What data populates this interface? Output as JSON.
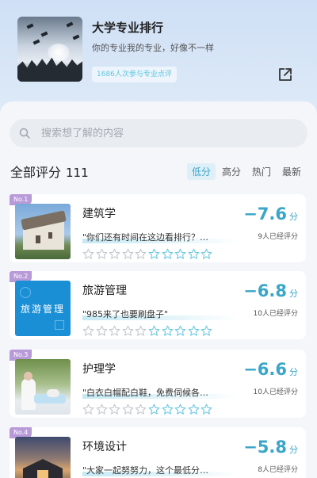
{
  "header": {
    "title": "大学专业排行",
    "subtitle": "你的专业我的专业，好像不一样",
    "joined": "1686人次参与专业点评",
    "share_icon": "share-icon"
  },
  "search": {
    "placeholder": "搜索想了解的内容",
    "value": ""
  },
  "list_header": {
    "label": "全部评分",
    "count": "111",
    "sort_tabs": [
      "低分",
      "高分",
      "热门",
      "最新"
    ],
    "active_sort": "低分"
  },
  "colors": {
    "accent": "#3aa6c8",
    "badge": "#b99ad9",
    "star_outline": "#c4c8cd",
    "star_highlight": "#6dc9e2"
  },
  "items": [
    {
      "rank": "No.1",
      "name": "建筑学",
      "quote": "\"你们还有时间在这边看排行？…",
      "score": "−7.6",
      "unit": "分",
      "raters": "9人已经评分",
      "highlight_stars": 5
    },
    {
      "rank": "No.2",
      "name": "旅游管理",
      "quote": "\"985来了也要刷盘子\"",
      "score": "−6.8",
      "unit": "分",
      "raters": "10人已经评分",
      "highlight_stars": 5,
      "thumb_text": "旅游管理"
    },
    {
      "rank": "No.3",
      "name": "护理学",
      "quote": "\"白衣白帽配白鞋，免费伺候各…",
      "score": "−6.6",
      "unit": "分",
      "raters": "10人已经评分",
      "highlight_stars": 5
    },
    {
      "rank": "No.4",
      "name": "环境设计",
      "quote": "\"大家一起努努力，这个最低分…",
      "score": "−5.8",
      "unit": "分",
      "raters": "8人已经评分",
      "highlight_stars": 5
    }
  ]
}
